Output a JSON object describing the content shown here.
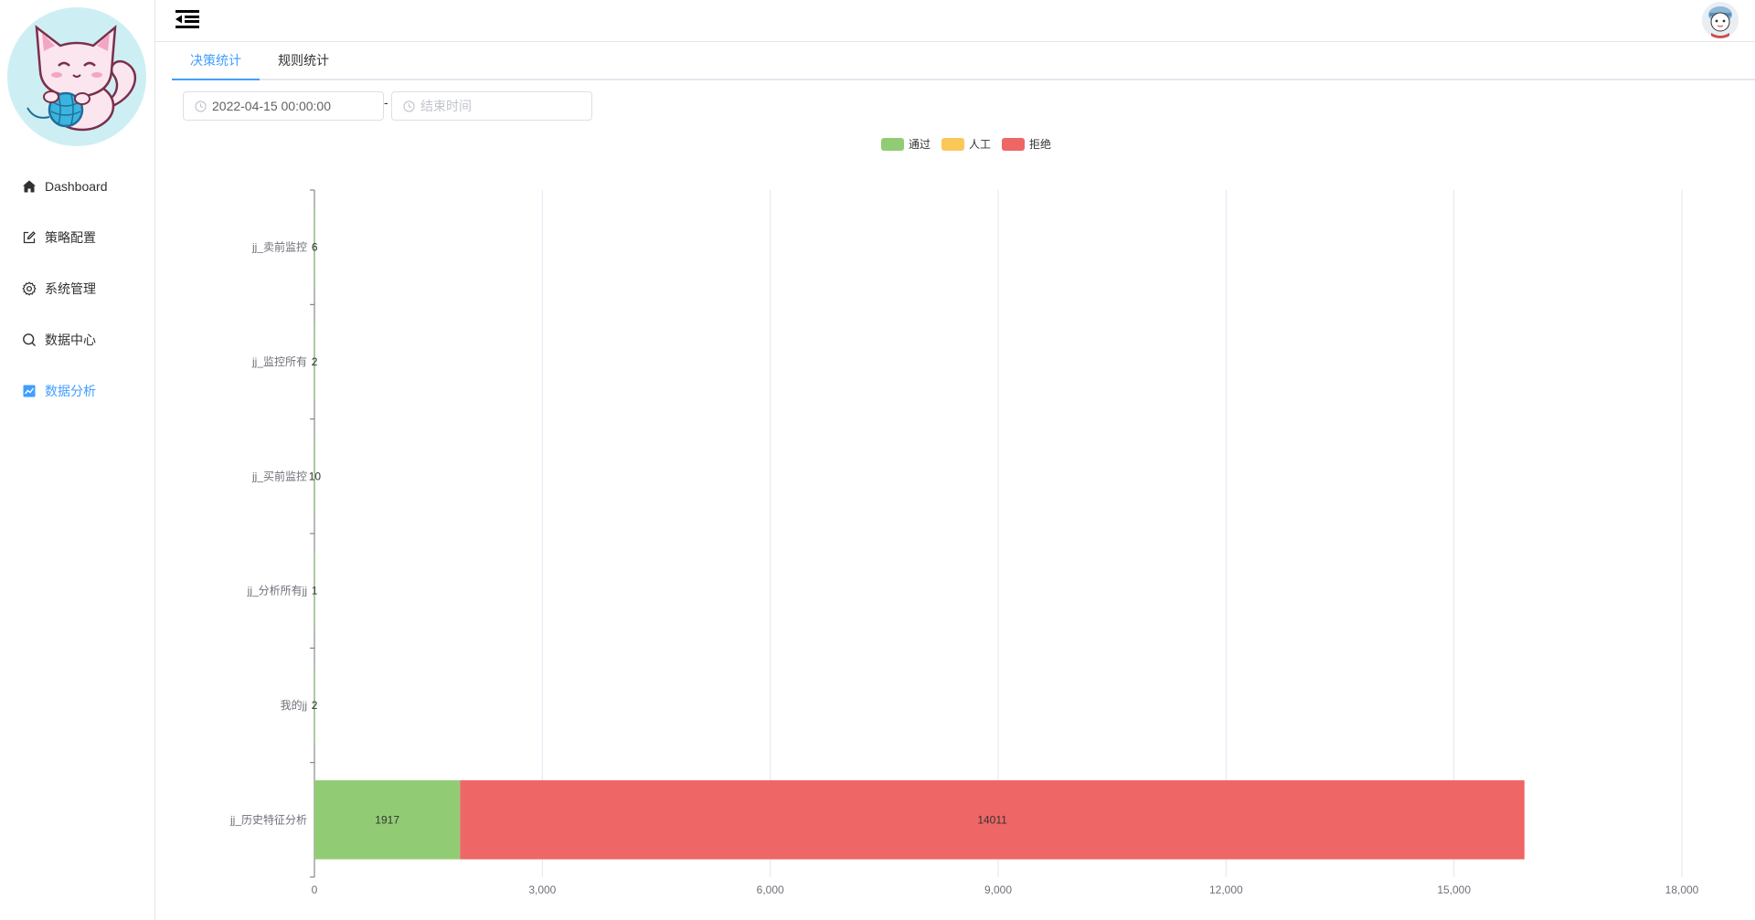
{
  "sidebar": {
    "items": [
      {
        "label": "Dashboard",
        "icon": "home-icon",
        "active": false
      },
      {
        "label": "策略配置",
        "icon": "edit-icon",
        "active": false
      },
      {
        "label": "系统管理",
        "icon": "gear-icon",
        "active": false
      },
      {
        "label": "数据中心",
        "icon": "search-icon",
        "active": false
      },
      {
        "label": "数据分析",
        "icon": "chart-icon",
        "active": true
      }
    ]
  },
  "tabs": [
    {
      "label": "决策统计",
      "active": true
    },
    {
      "label": "规则统计",
      "active": false
    }
  ],
  "filters": {
    "start_time": "2022-04-15 00:00:00",
    "end_placeholder": "结束时间",
    "separator": "-"
  },
  "colors": {
    "accent": "#409eff",
    "pass": "#91cc75",
    "manual": "#fac858",
    "reject": "#ee6666"
  },
  "chart_data": {
    "type": "bar",
    "orientation": "horizontal",
    "stacked": true,
    "categories": [
      "jj_历史特征分析",
      "我的jj",
      "jj_分析所有jj",
      "jj_买前监控",
      "jj_监控所有",
      "jj_卖前监控"
    ],
    "series": [
      {
        "name": "通过",
        "color": "#91cc75",
        "values": [
          1917,
          2,
          1,
          10,
          2,
          6
        ]
      },
      {
        "name": "人工",
        "color": "#fac858",
        "values": [
          0,
          0,
          0,
          0,
          0,
          0
        ]
      },
      {
        "name": "拒绝",
        "color": "#ee6666",
        "values": [
          14011,
          0,
          0,
          0,
          0,
          0
        ]
      }
    ],
    "visible_labels": [
      {
        "text": "1917"
      },
      {
        "text": "14011"
      },
      {
        "text": "2"
      },
      {
        "text": "1"
      },
      {
        "text": "10"
      },
      {
        "text": "2"
      },
      {
        "text": "6"
      }
    ],
    "xlim": [
      0,
      18000
    ],
    "xticks": [
      "0",
      "3,000",
      "6,000",
      "9,000",
      "12,000",
      "15,000",
      "18,000"
    ],
    "legend_position": "top-center",
    "grid": true
  }
}
